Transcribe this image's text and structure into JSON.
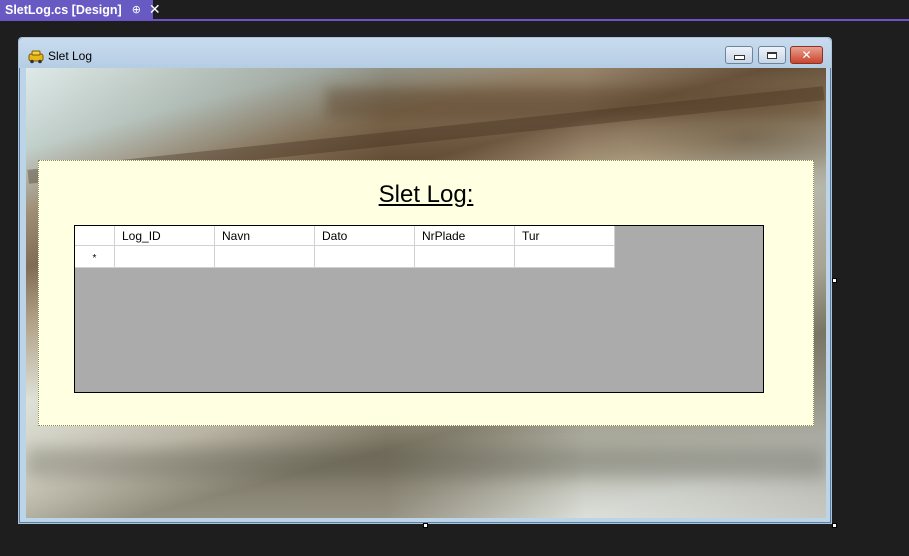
{
  "tab": {
    "title": "SletLog.cs [Design]",
    "pin_glyph": "⊕",
    "close_glyph": "✕"
  },
  "form": {
    "title": "Slet Log",
    "close_glyph": "✕"
  },
  "panel": {
    "heading": "Slet Log:"
  },
  "grid": {
    "columns": [
      "Log_ID",
      "Navn",
      "Dato",
      "NrPlade",
      "Tur"
    ],
    "new_row_marker": "*"
  },
  "colors": {
    "tab_accent": "#685ac3",
    "panel_background": "#ffffe1",
    "grid_background": "#ababab"
  }
}
